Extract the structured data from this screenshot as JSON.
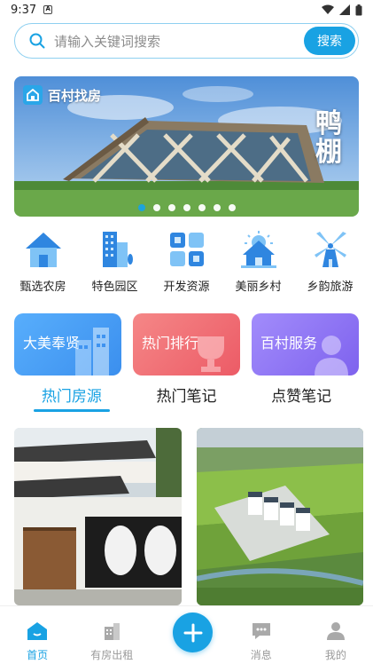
{
  "status_bar": {
    "time": "9:37",
    "notification_badge": "A"
  },
  "search": {
    "placeholder": "请输入关键词搜索",
    "button_label": "搜索"
  },
  "banner": {
    "logo_text": "百村找房",
    "vertical_text": "鸭\n棚",
    "dots_count": 7,
    "active_dot": 0
  },
  "categories": [
    {
      "label": "甄选农房",
      "icon": "house-icon"
    },
    {
      "label": "特色园区",
      "icon": "buildings-icon"
    },
    {
      "label": "开发资源",
      "icon": "grid-icon"
    },
    {
      "label": "美丽乡村",
      "icon": "village-icon"
    },
    {
      "label": "乡韵旅游",
      "icon": "windmill-icon"
    }
  ],
  "feature_cards": [
    {
      "label": "大美奉贤",
      "color": "#4a9ff5"
    },
    {
      "label": "热门排行",
      "color": "#ef6c74"
    },
    {
      "label": "百村服务",
      "color": "#8d74f4"
    }
  ],
  "tabs": [
    {
      "label": "热门房源",
      "active": true
    },
    {
      "label": "热门笔记",
      "active": false
    },
    {
      "label": "点赞笔记",
      "active": false
    }
  ],
  "bottom_nav": {
    "items": [
      {
        "label": "首页",
        "icon": "home-icon",
        "active": true
      },
      {
        "label": "有房出租",
        "icon": "rent-icon",
        "active": false
      },
      {
        "label": "消息",
        "icon": "message-icon",
        "active": false
      },
      {
        "label": "我的",
        "icon": "user-icon",
        "active": false
      }
    ],
    "fab_icon": "plus-icon"
  },
  "colors": {
    "accent": "#19a2e3"
  }
}
